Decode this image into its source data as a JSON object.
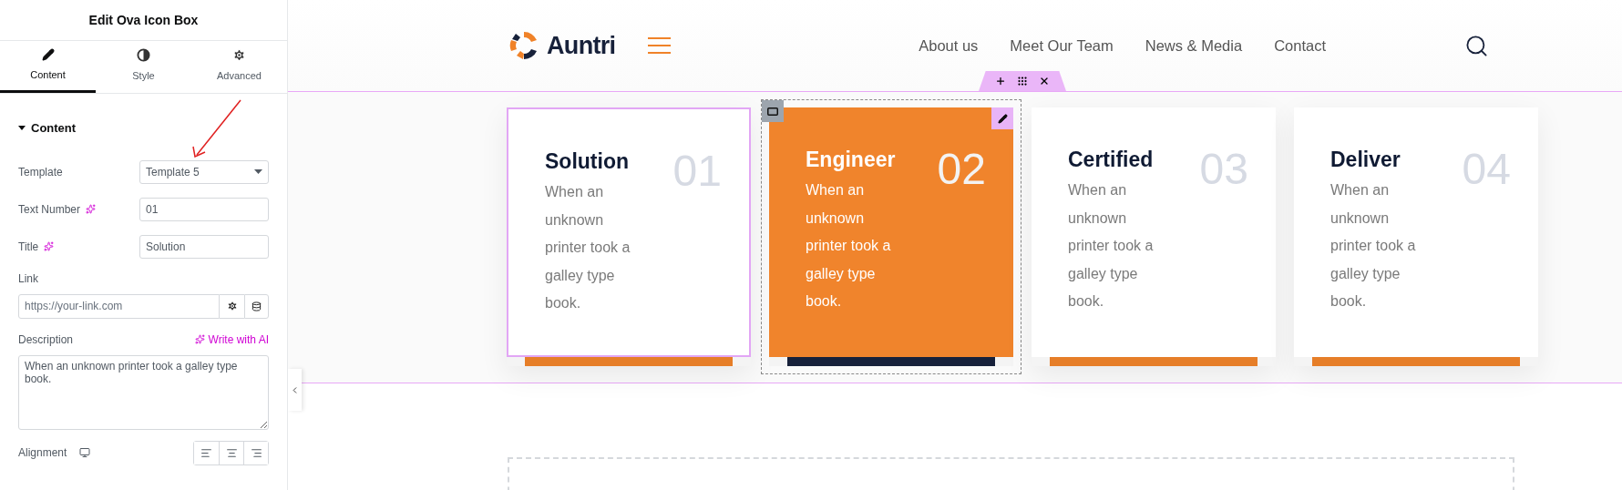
{
  "panel": {
    "title": "Edit Ova Icon Box",
    "tabs": [
      {
        "label": "Content",
        "selected": true
      },
      {
        "label": "Style",
        "selected": false
      },
      {
        "label": "Advanced",
        "selected": false
      }
    ],
    "section": {
      "label": "Content",
      "expanded": true
    },
    "template": {
      "label": "Template",
      "value": "Template 5"
    },
    "text_number": {
      "label": "Text Number",
      "value": "01"
    },
    "title_field": {
      "label": "Title",
      "value": "Solution"
    },
    "link": {
      "label": "Link",
      "placeholder": "https://your-link.com"
    },
    "description": {
      "label": "Description",
      "ai_link": "Write with AI",
      "value": "When an unknown printer took a galley type book."
    },
    "alignment": {
      "label": "Alignment",
      "options": [
        {
          "kind": "left",
          "selected": false
        },
        {
          "kind": "center",
          "selected": false
        },
        {
          "kind": "right",
          "selected": false
        }
      ]
    }
  },
  "site": {
    "logo": "Auntri",
    "nav": [
      "About us",
      "Meet Our Team",
      "News & Media",
      "Contact"
    ],
    "cards": [
      {
        "title": "Solution",
        "number": "01",
        "description": "When an unknown printer took a galley type book.",
        "highlighted": false,
        "outlined": true
      },
      {
        "title": "Engineer",
        "number": "02",
        "description": "When an unknown printer took a galley type book.",
        "highlighted": true,
        "outlined": false
      },
      {
        "title": "Certified",
        "number": "03",
        "description": "When an unknown printer took a galley type book.",
        "highlighted": false,
        "outlined": false
      },
      {
        "title": "Deliver",
        "number": "04",
        "description": "When an unknown printer took a galley type book.",
        "highlighted": false,
        "outlined": false
      }
    ]
  }
}
